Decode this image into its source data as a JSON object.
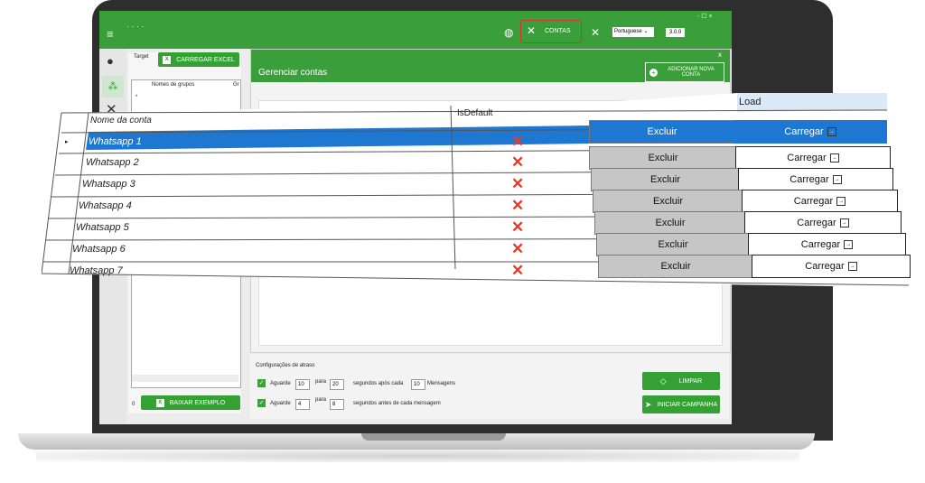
{
  "titlebar": {
    "language": "Portuguese",
    "version": "3.0.0",
    "contas_label": "CONTAS",
    "window_controls": "- ☐ ×"
  },
  "left_panel": {
    "target_label": "Target",
    "load_excel_button": "CARREGAR EXCEL",
    "group_column": "Nomes de grupos",
    "group_column_2": "Gr",
    "row_marker": "*",
    "count": "0",
    "download_example_button": "BAIXAR EXEMPLO"
  },
  "dialog": {
    "title": "Gerenciar contas",
    "add_account_button": "ADICIONAR NOVA CONTA",
    "close": "x"
  },
  "grid": {
    "columns": {
      "name": "Nome da conta",
      "is_default": "IsDefault",
      "load": "Load"
    },
    "rows": [
      {
        "name": "Whatsapp 1",
        "is_default": "✕",
        "delete": "Excluir",
        "load": "Carregar"
      },
      {
        "name": "Whatsapp 2",
        "is_default": "✕",
        "delete": "Excluir",
        "load": "Carregar"
      },
      {
        "name": "Whatsapp 3",
        "is_default": "✕",
        "delete": "Excluir",
        "load": "Carregar"
      },
      {
        "name": "Whatsapp 4",
        "is_default": "✕",
        "delete": "Excluir",
        "load": "Carregar"
      },
      {
        "name": "Whatsapp 5",
        "is_default": "✕",
        "delete": "Excluir",
        "load": "Carregar"
      },
      {
        "name": "Whatsapp 6",
        "is_default": "✕",
        "delete": "Excluir",
        "load": "Carregar"
      },
      {
        "name": "Whatsapp 7",
        "is_default": "✕",
        "delete": "Excluir",
        "load": "Carregar"
      }
    ],
    "selected_row": "Whatsapp 1"
  },
  "delay": {
    "title": "Configurações de atraso",
    "row1": {
      "aguarde": "Aguarde",
      "from": "10",
      "para": "para",
      "to": "20",
      "after": "segundos após cada",
      "count": "10",
      "mensagens": "Mensagens"
    },
    "row2": {
      "aguarde": "Aguarde",
      "from": "4",
      "para": "para",
      "to": "8",
      "after": "segundos antes de cada mensagem"
    },
    "clear_button": "LIMPAR",
    "start_button": "INICIAR CAMPANHA"
  },
  "colors": {
    "accent": "#3a9e3a",
    "selected_row": "#1e78d2",
    "delete_mark": "#e53b2c"
  }
}
